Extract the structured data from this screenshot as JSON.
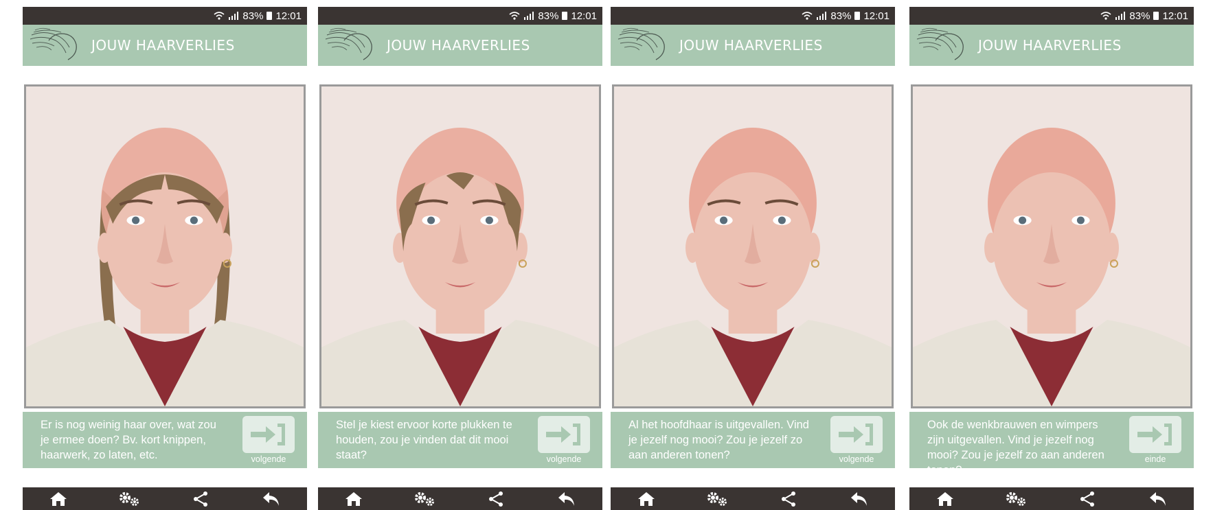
{
  "status": {
    "battery": "83%",
    "time": "12:01"
  },
  "app": {
    "title": "JOUW HAARVERLIES"
  },
  "screens": [
    {
      "caption": "Er is nog weinig haar over, wat zou je ermee doen? Bv. kort knippen, haarwerk, zo laten, etc.",
      "button_label": "volgende",
      "hair": "partial",
      "brows": true
    },
    {
      "caption": "Stel je kiest ervoor korte plukken te houden, zou je vinden dat dit mooi staat?",
      "button_label": "volgende",
      "hair": "tufts",
      "brows": true
    },
    {
      "caption": "Al het hoofdhaar is uitgevallen. Vind je jezelf nog mooi? Zou je jezelf zo aan anderen tonen?",
      "button_label": "volgende",
      "hair": "none",
      "brows": true
    },
    {
      "caption": "Ook de wenkbrauwen en wimpers zijn uitgevallen. Vind je jezelf nog mooi? Zou je jezelf zo aan anderen tonen?",
      "button_label": "einde",
      "hair": "none",
      "brows": false
    }
  ],
  "colors": {
    "header": "#a9c8b1",
    "bar": "#3a3432",
    "frame": "#9a9a9a"
  },
  "icons": {
    "home": "home-icon",
    "settings": "settings-icon",
    "share": "share-icon",
    "back": "back-arrow-icon",
    "next": "exit-arrow-icon"
  }
}
